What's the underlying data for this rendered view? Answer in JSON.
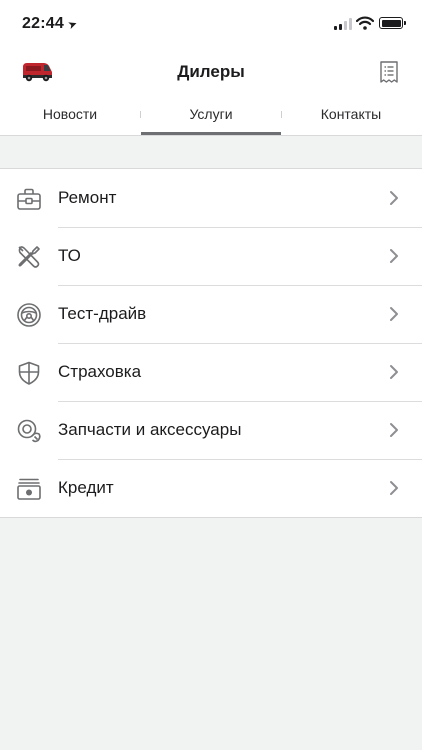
{
  "status_bar": {
    "time": "22:44",
    "location_icon": "location-arrow-icon",
    "signal_icon": "cellular-signal-icon",
    "wifi_icon": "wifi-icon",
    "battery_icon": "battery-icon"
  },
  "header": {
    "title": "Дилеры",
    "left_icon": "van-icon",
    "right_icon": "receipt-icon"
  },
  "tabs": [
    {
      "label": "Новости",
      "selected": false
    },
    {
      "label": "Услуги",
      "selected": true
    },
    {
      "label": "Контакты",
      "selected": false
    }
  ],
  "services": [
    {
      "label": "Ремонт",
      "icon": "toolbox-icon"
    },
    {
      "label": "ТО",
      "icon": "wrench-screwdriver-icon"
    },
    {
      "label": "Тест-драйв",
      "icon": "steering-wheel-icon"
    },
    {
      "label": "Страховка",
      "icon": "shield-icon"
    },
    {
      "label": "Запчасти и аксессуары",
      "icon": "parts-icon"
    },
    {
      "label": "Кредит",
      "icon": "credit-cash-icon"
    }
  ],
  "colors": {
    "accent_indicator": "#6e6f73",
    "icon": "#6d6e70",
    "background": "#f1f2f2",
    "van_red": "#c0262d"
  }
}
